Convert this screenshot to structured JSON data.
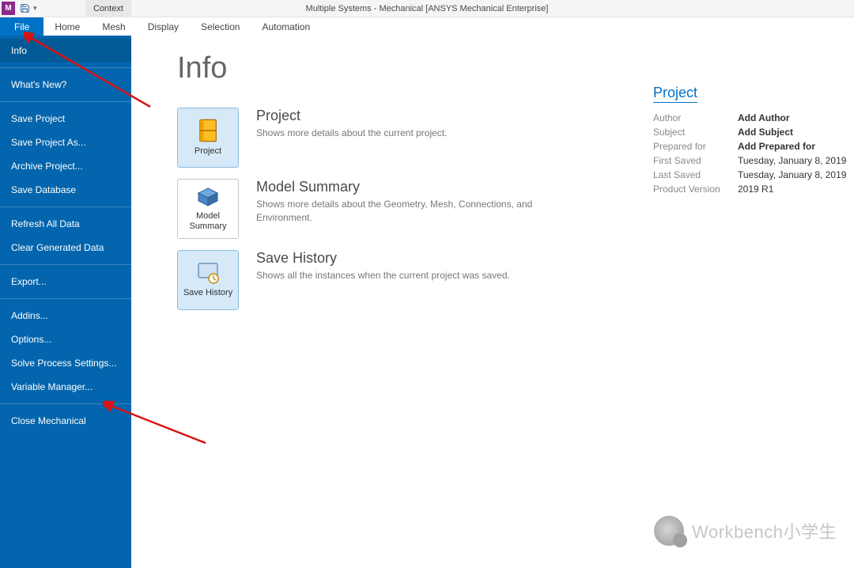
{
  "qat": {
    "appLetter": "M"
  },
  "title": "Multiple Systems - Mechanical [ANSYS Mechanical Enterprise]",
  "context": {
    "label": "Context"
  },
  "ribbon": {
    "tabs": [
      {
        "label": "File",
        "selected": true
      },
      {
        "label": "Home"
      },
      {
        "label": "Mesh"
      },
      {
        "label": "Display"
      },
      {
        "label": "Selection"
      },
      {
        "label": "Automation"
      }
    ]
  },
  "sidebar": {
    "groups": [
      [
        {
          "label": "Info",
          "selected": true
        }
      ],
      [
        {
          "label": "What's New?"
        }
      ],
      [
        {
          "label": "Save Project"
        },
        {
          "label": "Save Project As..."
        },
        {
          "label": "Archive Project..."
        },
        {
          "label": "Save Database"
        }
      ],
      [
        {
          "label": "Refresh All Data"
        },
        {
          "label": "Clear Generated Data"
        }
      ],
      [
        {
          "label": "Export..."
        }
      ],
      [
        {
          "label": "Addins..."
        },
        {
          "label": "Options..."
        },
        {
          "label": "Solve Process Settings..."
        },
        {
          "label": "Variable Manager..."
        }
      ],
      [
        {
          "label": "Close Mechanical"
        }
      ]
    ]
  },
  "main": {
    "title": "Info",
    "items": [
      {
        "tile": "Project",
        "head": "Project",
        "desc": "Shows more details about the current project.",
        "selected": true,
        "icon": "project"
      },
      {
        "tile": "Model Summary",
        "head": "Model Summary",
        "desc": "Shows more details about the Geometry, Mesh, Connections, and Environment.",
        "icon": "model"
      },
      {
        "tile": "Save History",
        "head": "Save History",
        "desc": "Shows all the instances when the current project was saved.",
        "selected": true,
        "icon": "history"
      }
    ]
  },
  "project": {
    "head": "Project",
    "rows": [
      {
        "k": "Author",
        "v": "Add Author",
        "bold": true
      },
      {
        "k": "Subject",
        "v": "Add Subject",
        "bold": true
      },
      {
        "k": "Prepared for",
        "v": "Add Prepared for",
        "bold": true
      },
      {
        "k": "First Saved",
        "v": "Tuesday, January 8, 2019"
      },
      {
        "k": "Last Saved",
        "v": "Tuesday, January 8, 2019"
      },
      {
        "k": "Product Version",
        "v": "2019 R1"
      }
    ]
  },
  "watermark": "Workbench小学生"
}
